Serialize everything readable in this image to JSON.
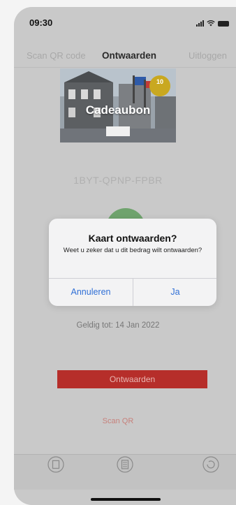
{
  "status_bar": {
    "time": "09:30"
  },
  "tabs": {
    "scan": "Scan QR code",
    "ontwaarden": "Ontwaarden",
    "uitloggen": "Uitloggen"
  },
  "card": {
    "title": "Cadeaubon",
    "badge_number": "10"
  },
  "voucher": {
    "code": "1BYT-QPNP-FPBR",
    "valid_until": "Geldig tot: 14 Jan 2022"
  },
  "actions": {
    "redeem_button": "Ontwaarden",
    "scan_link": "Scan QR"
  },
  "dialog": {
    "title": "Kaart ontwaarden?",
    "message": "Weet u zeker dat u dit bedrag wilt ontwaarden?",
    "cancel": "Annuleren",
    "confirm": "Ja"
  },
  "colors": {
    "accent_red": "#b62e2a",
    "dialog_link_blue": "#2f6fd6",
    "card_badge_gold": "#c9a820"
  }
}
